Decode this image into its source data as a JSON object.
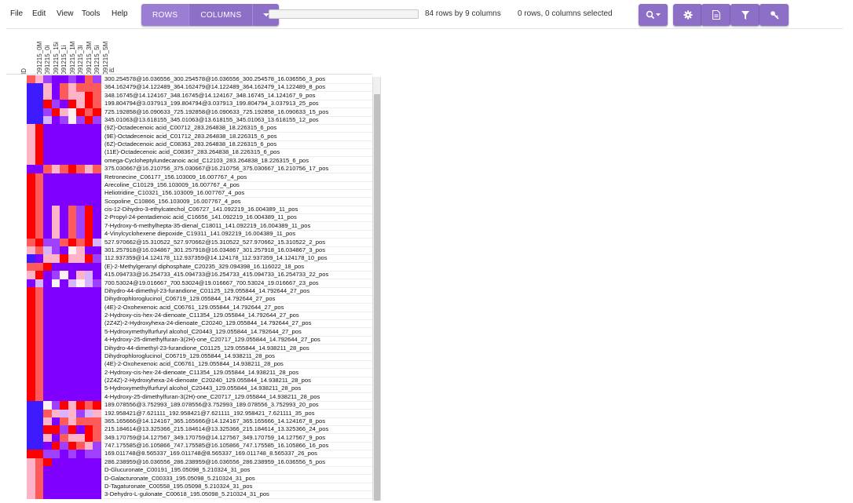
{
  "menu": [
    "File",
    "Edit",
    "View",
    "Tools",
    "Help"
  ],
  "toolbar": {
    "rows_label": "ROWS",
    "columns_label": "COLUMNS",
    "search_placeholder": "",
    "row_count_text": "84 rows by 9 columns",
    "selection_text": "0 rows, 0 columns selected",
    "icons": [
      "zoom-dropdown-icon",
      "gear-icon",
      "file-icon",
      "filter-icon",
      "key-icon"
    ],
    "accent_color": "#8e6fc8"
  },
  "columns": [
    "ID",
    "091215_0M",
    "091215_0i",
    "091215_15i",
    "091215_1i",
    "091215_1M",
    "091215_3i",
    "091215_3M",
    "091215_5i",
    "091215_5M"
  ],
  "id_header": "id",
  "palette": {
    "R": "#ff0000",
    "r": "#ff5a5a",
    "p": "#ffb3c8",
    "w": "#fff0f4",
    "l": "#d8b4ff",
    "m": "#a040ff",
    "M": "#7f00ff",
    "B": "#3c1cff"
  },
  "rows": [
    {
      "label": "300.254578@16.036556_300.254578@16.036556_300.254578_16.036556_3_pos",
      "cells": "rpmMMmMrm"
    },
    {
      "label": "364.162479@14.122489_364.162479@14.122489_364.162479_14.122489_8_pos",
      "cells": "BBpMrprrr"
    },
    {
      "label": "348.16745@14.124167_348.16745@14.124167_348.16745_14.124167_9_pos",
      "cells": "BBpMrppRr"
    },
    {
      "label": "199.804794@3.037913_199.804794@3.037913_199.804794_3.037913_25_pos",
      "cells": "BBRmMRpRr"
    },
    {
      "label": "725.192858@16.090633_725.192858@16.090633_725.192858_16.090633_15_pos",
      "cells": "BBmRpwRrR"
    },
    {
      "label": "345.01063@13.618155_345.01063@13.618155_345.01063_13.618155_12_pos",
      "cells": "BBlMmwmRm"
    },
    {
      "label": "(9Z)-Octadecenoic acid_C00712_283.264838_18.226315_6_pos",
      "cells": "pRMMMMMMM"
    },
    {
      "label": "(9E)-Octadecenoic acid_C01712_283.264838_18.226315_6_pos",
      "cells": "pRMMMMMMM"
    },
    {
      "label": "(6Z)-Octadecenoic acid_C08363_283.264838_18.226315_6_pos",
      "cells": "pRMMMMMMM"
    },
    {
      "label": "(11E)-Octadecenoic acid_C08367_283.264838_18.226315_6_pos",
      "cells": "pRMMMMMMM"
    },
    {
      "label": "omega-Cycloheptylundecanoic acid_C12103_283.264838_18.226315_6_pos",
      "cells": "pRMMMMMMM"
    },
    {
      "label": "375.030667@16.210756_375.030667@16.210756_375.030667_16.210756_17_pos",
      "cells": "MMrprRrpr"
    },
    {
      "label": "Retronecine_C06177_156.103009_16.007767_4_pos",
      "cells": "RrMMMMMMM"
    },
    {
      "label": "Arecoline_C10129_156.103009_16.007767_4_pos",
      "cells": "RrMMMMMMM"
    },
    {
      "label": "Heliotridine_C10321_156.103009_16.007767_4_pos",
      "cells": "RrMMMMMMM"
    },
    {
      "label": "Scopoline_C10866_156.103009_16.007767_4_pos",
      "cells": "RrMMMMMMM"
    },
    {
      "label": "cis-12-Dihydro-3-ethylcatechol_C06727_141.092219_16.004389_11_pos",
      "cells": "RrMpMrmRM"
    },
    {
      "label": "2-Propyl-24-pentadienoic acid_C16656_141.092219_16.004389_11_pos",
      "cells": "RrMpMrmRM"
    },
    {
      "label": "7-Hydroxy-6-methylhepta-35-dienal_C18011_141.092219_16.004389_11_pos",
      "cells": "RrMpMrmRM"
    },
    {
      "label": "4-Vinylcyclohexene diepoxide_C19311_141.092219_16.004389_11_pos",
      "cells": "RrMpMrmRM"
    },
    {
      "label": "527.970662@15.310522_527.970662@15.310522_527.970662_15.310522_2_pos",
      "cells": "rRmmrRrRl"
    },
    {
      "label": "301.257918@16.034867_301.257918@16.034867_301.257918_16.034867_3_pos",
      "cells": "prlmMwpMM"
    },
    {
      "label": "112.937359@14.124178_112.937359@14.124178_112.937359_14.124178_10_pos",
      "cells": "BMppRppRm"
    },
    {
      "label": "(E)-2-Methylgeranyl diphosphate_C20235_329.094398_16.116022_18_pos",
      "cells": "rrRMMMMMM"
    },
    {
      "label": "415.094733@16.254733_415.094733@16.254733_415.094733_16.254733_22_pos",
      "cells": "pRMmwMplM"
    },
    {
      "label": "700.53024@19.016667_700.53024@19.016667_700.53024_19.016667_23_pos",
      "cells": "MlMwMlwlm"
    },
    {
      "label": "Dihydro-44-dimethyl-23-furandione_C01125_129.055844_14.792644_27_pos",
      "cells": "RrMMMMMMM"
    },
    {
      "label": "Dihydrophloroglucinol_C06719_129.055844_14.792644_27_pos",
      "cells": "RrMMMMMMM"
    },
    {
      "label": "(4E)-2-Oxohexenoic acid_C06761_129.055844_14.792644_27_pos",
      "cells": "RrMMMMMMM"
    },
    {
      "label": "2-Hydroxy-cis-hex-24-dienoate_C11354_129.055844_14.792644_27_pos",
      "cells": "RrMMMMMMM"
    },
    {
      "label": "(2Z4Z)-2-Hydroxyhexa-24-dienoate_C20240_129.055844_14.792644_27_pos",
      "cells": "RrMMMMMMM"
    },
    {
      "label": "5-Hydroxymethylfurfuryl alcohol_C20443_129.055844_14.792644_27_pos",
      "cells": "RrMMMMMMM"
    },
    {
      "label": "4-Hydroxy-25-dimethylfuran-3(2H)-one_C20717_129.055844_14.792644_27_pos",
      "cells": "RrMMMMMMM"
    },
    {
      "label": "Dihydro-44-dimethyl-23-furandione_C01125_129.055844_14.938211_28_pos",
      "cells": "RrMMMMMMM"
    },
    {
      "label": "Dihydrophloroglucinol_C06719_129.055844_14.938211_28_pos",
      "cells": "RrMMMMMMM"
    },
    {
      "label": "(4E)-2-Oxohexenoic acid_C06761_129.055844_14.938211_28_pos",
      "cells": "RrMMMMMMM"
    },
    {
      "label": "2-Hydroxy-cis-hex-24-dienoate_C11354_129.055844_14.938211_28_pos",
      "cells": "RrMMMMMMM"
    },
    {
      "label": "(2Z4Z)-2-Hydroxyhexa-24-dienoate_C20240_129.055844_14.938211_28_pos",
      "cells": "RrMMMMMMM"
    },
    {
      "label": "5-Hydroxymethylfurfuryl alcohol_C20443_129.055844_14.938211_28_pos",
      "cells": "RrMMMMMMM"
    },
    {
      "label": "4-Hydroxy-25-dimethylfuran-3(2H)-one_C20717_129.055844_14.938211_28_pos",
      "cells": "RrMMMMMMM"
    },
    {
      "label": "189.078556@3.752993_189.078556@3.752993_189.078556_3.752993_20_pos",
      "cells": "BBwmRpRrR"
    },
    {
      "label": "192.958421@7.621111_192.958421@7.621111_192.958421_7.621111_35_pos",
      "cells": "BBrplpmlp"
    },
    {
      "label": "365.165666@14.124167_365.165666@14.124167_365.165666_14.124167_8_pos",
      "cells": "BBpMrprrr"
    },
    {
      "label": "215.184614@13.325366_215.184614@13.325366_215.184614_13.325366_24_pos",
      "cells": "BBRRmRMRr"
    },
    {
      "label": "349.170759@14.127567_349.170759@14.127567_349.170759_14.127567_9_pos",
      "cells": "BBpMrppRr"
    },
    {
      "label": "747.175585@16.105866_747.175585@16.105866_747.175585_16.105866_16_pos",
      "cells": "BBMRmRrpm"
    },
    {
      "label": "169.011748@8.565337_169.011748@8.565337_169.011748_8.565337_26_pos",
      "cells": "RRmmMmMmm"
    },
    {
      "label": "286.238959@16.036556_286.238959@16.036556_286.238959_16.036556_5_pos",
      "cells": "prRMMMMMM"
    },
    {
      "label": "D-Glucuronate_C00191_195.05098_5.210324_31_pos",
      "cells": "prMMMMMMM"
    },
    {
      "label": "D-Galacturonate_C00333_195.05098_5.210324_31_pos",
      "cells": "prMMMMMMM"
    },
    {
      "label": "D-Tagaturonate_C00558_195.05098_5.210324_31_pos",
      "cells": "prMMMMMMM"
    },
    {
      "label": "3-Dehydro-L-gulonate_C00618_195.05098_5.210324_31_pos",
      "cells": "prMMMMMMM"
    }
  ]
}
